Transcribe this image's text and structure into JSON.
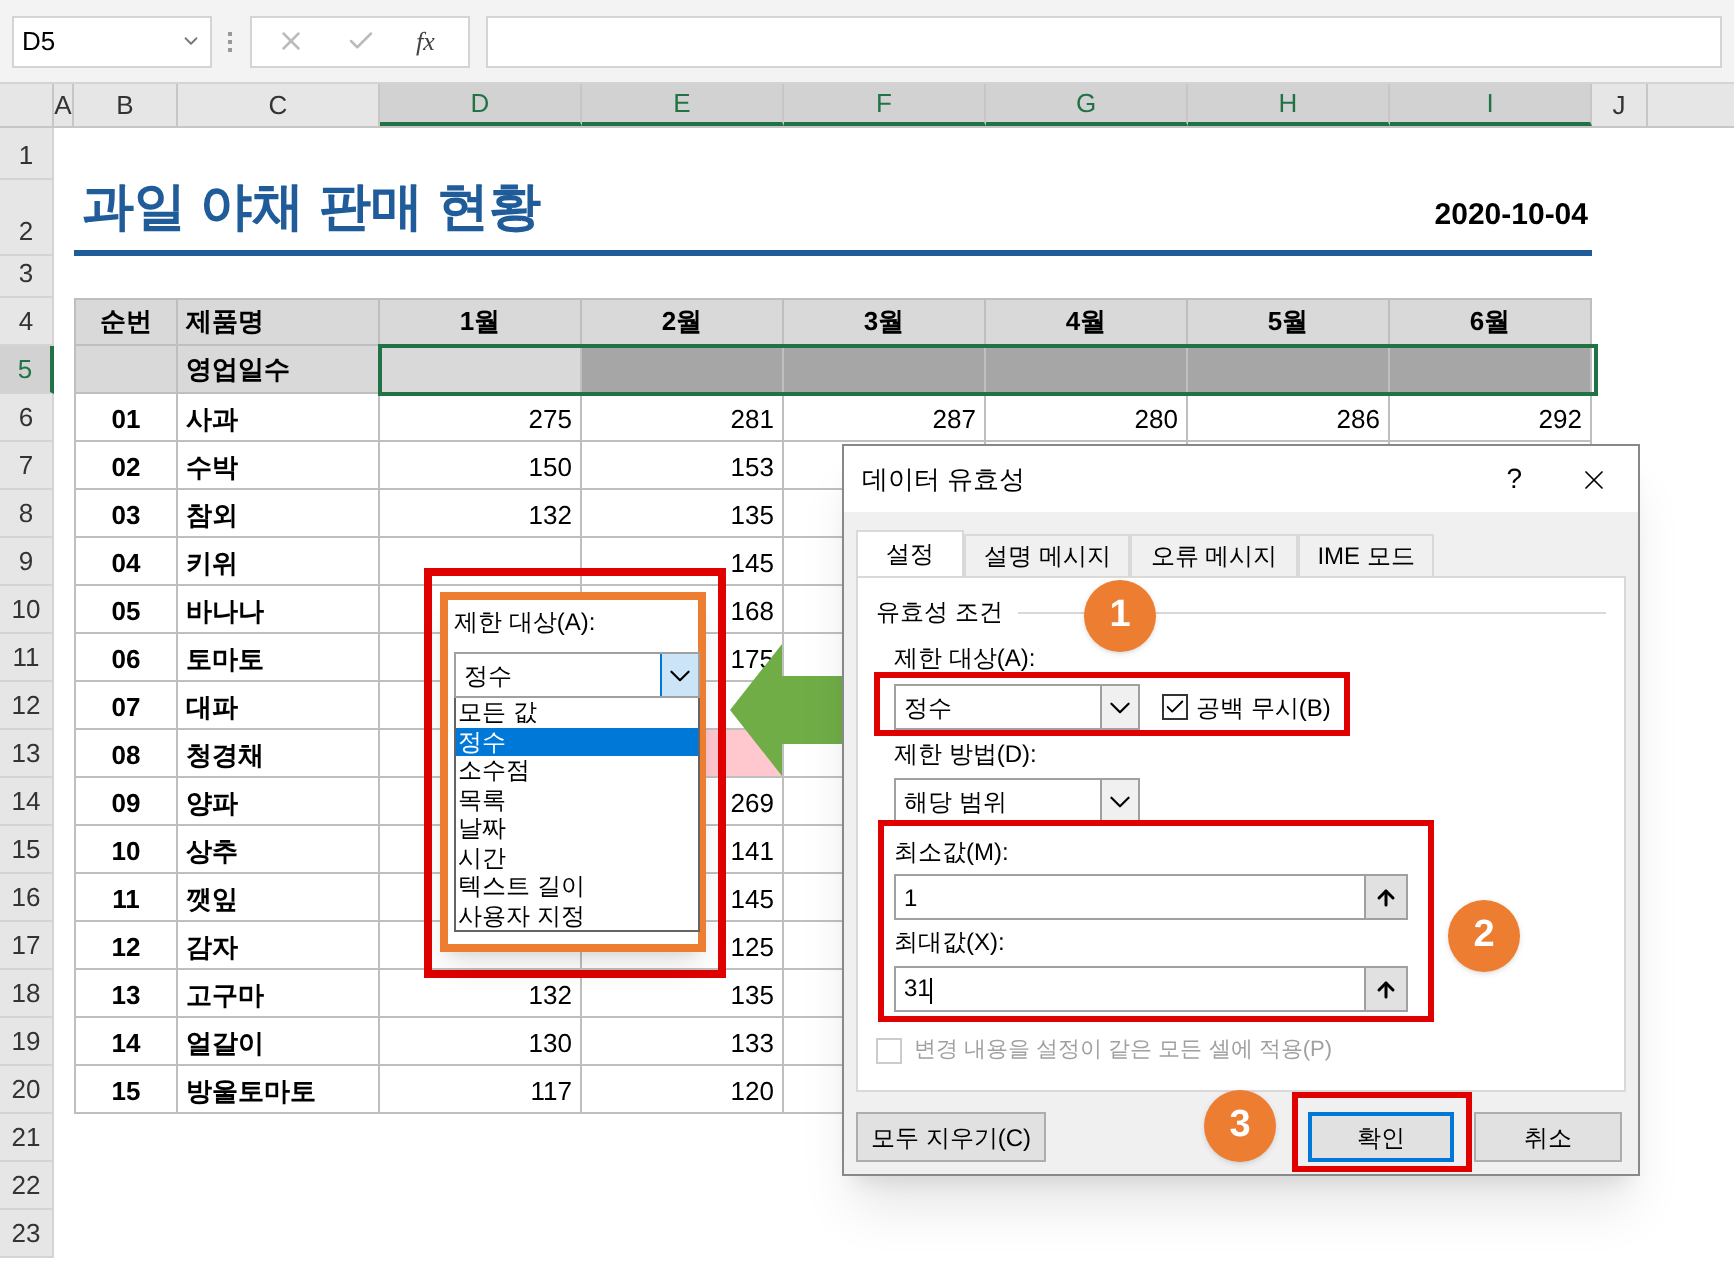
{
  "formula_bar": {
    "name_box": "D5",
    "function_label": "fx"
  },
  "columns": [
    {
      "label": "A",
      "selected": false
    },
    {
      "label": "B",
      "selected": false
    },
    {
      "label": "C",
      "selected": false
    },
    {
      "label": "D",
      "selected": true
    },
    {
      "label": "E",
      "selected": true
    },
    {
      "label": "F",
      "selected": true
    },
    {
      "label": "G",
      "selected": true
    },
    {
      "label": "H",
      "selected": true
    },
    {
      "label": "I",
      "selected": true
    },
    {
      "label": "J",
      "selected": false
    }
  ],
  "row_numbers": [
    {
      "label": "1",
      "selected": false
    },
    {
      "label": "2",
      "selected": false
    },
    {
      "label": "3",
      "selected": false
    },
    {
      "label": "4",
      "selected": false
    },
    {
      "label": "5",
      "selected": true
    },
    {
      "label": "6",
      "selected": false
    },
    {
      "label": "7",
      "selected": false
    },
    {
      "label": "8",
      "selected": false
    },
    {
      "label": "9",
      "selected": false
    },
    {
      "label": "10",
      "selected": false
    },
    {
      "label": "11",
      "selected": false
    },
    {
      "label": "12",
      "selected": false
    },
    {
      "label": "13",
      "selected": false
    },
    {
      "label": "14",
      "selected": false
    },
    {
      "label": "15",
      "selected": false
    },
    {
      "label": "16",
      "selected": false
    },
    {
      "label": "17",
      "selected": false
    },
    {
      "label": "18",
      "selected": false
    },
    {
      "label": "19",
      "selected": false
    },
    {
      "label": "20",
      "selected": false
    },
    {
      "label": "21",
      "selected": false
    },
    {
      "label": "22",
      "selected": false
    },
    {
      "label": "23",
      "selected": false
    }
  ],
  "sheet_title": "과일 야채 판매 현황",
  "date": "2020-10-04",
  "table": {
    "header": [
      "순번",
      "제품명",
      "1월",
      "2월",
      "3월",
      "4월",
      "5월",
      "6월"
    ],
    "subheader": "영업일수",
    "rows": [
      {
        "no": "01",
        "name": "사과",
        "values": [
          "275",
          "281",
          "287",
          "280",
          "286",
          "292"
        ]
      },
      {
        "no": "02",
        "name": "수박",
        "values": [
          "150",
          "153"
        ]
      },
      {
        "no": "03",
        "name": "참외",
        "values": [
          "132",
          "135"
        ]
      },
      {
        "no": "04",
        "name": "키위",
        "values": [
          {
            "kind": "covered"
          },
          "145"
        ]
      },
      {
        "no": "05",
        "name": "바나나",
        "values": [
          {
            "kind": "covered"
          },
          "168"
        ]
      },
      {
        "no": "06",
        "name": "토마토",
        "values": [
          {
            "kind": "covered"
          },
          "175"
        ]
      },
      {
        "no": "07",
        "name": "대파",
        "values": [
          {
            "kind": "covered"
          },
          {
            "kind": "covered"
          }
        ]
      },
      {
        "no": "08",
        "name": "청경채",
        "values": [
          {
            "kind": "covered"
          },
          {
            "kind": "highlighted"
          }
        ]
      },
      {
        "no": "09",
        "name": "양파",
        "values": [
          {
            "kind": "covered"
          },
          "269"
        ]
      },
      {
        "no": "10",
        "name": "상추",
        "values": [
          {
            "kind": "covered"
          },
          "141"
        ]
      },
      {
        "no": "11",
        "name": "깻잎",
        "values": [
          {
            "kind": "covered"
          },
          "145"
        ]
      },
      {
        "no": "12",
        "name": "감자",
        "values": [
          {
            "kind": "covered"
          },
          "125"
        ]
      },
      {
        "no": "13",
        "name": "고구마",
        "values": [
          "132",
          "135"
        ]
      },
      {
        "no": "14",
        "name": "얼갈이",
        "values": [
          "130",
          "133"
        ]
      },
      {
        "no": "15",
        "name": "방울토마토",
        "values": [
          "117",
          "120"
        ]
      }
    ]
  },
  "callout": {
    "label": "제한 대상(A):",
    "value": "정수",
    "options": [
      {
        "label": "모든 값",
        "selected": false
      },
      {
        "label": "정수",
        "selected": true
      },
      {
        "label": "소수점",
        "selected": false
      },
      {
        "label": "목록",
        "selected": false
      },
      {
        "label": "날짜",
        "selected": false
      },
      {
        "label": "시간",
        "selected": false
      },
      {
        "label": "텍스트 길이",
        "selected": false
      },
      {
        "label": "사용자 지정",
        "selected": false
      }
    ]
  },
  "dialog": {
    "title": "데이터 유효성",
    "help": "?",
    "tabs": [
      {
        "label": "설정",
        "selected": true
      },
      {
        "label": "설명 메시지",
        "selected": false
      },
      {
        "label": "오류 메시지",
        "selected": false
      },
      {
        "label": "IME 모드",
        "selected": false
      }
    ],
    "group": "유효성 조건",
    "allow_label": "제한 대상(A):",
    "allow_value": "정수",
    "ignore_blank": {
      "label": "공백 무시(B)",
      "checked": true
    },
    "data_label": "제한 방법(D):",
    "data_value": "해당 범위",
    "min_label": "최소값(M):",
    "min_value": "1",
    "max_label": "최대값(X):",
    "max_value": "31",
    "apply_all": {
      "label": "변경 내용을 설정이 같은 모든 셀에 적용(P)",
      "checked": false,
      "disabled": true
    },
    "buttons": [
      {
        "label": "모두 지우기(C)",
        "kind": "clear"
      },
      {
        "label": "확인",
        "kind": "ok"
      },
      {
        "label": "취소",
        "kind": "cancel"
      }
    ]
  },
  "steps": [
    "1",
    "2",
    "3"
  ]
}
